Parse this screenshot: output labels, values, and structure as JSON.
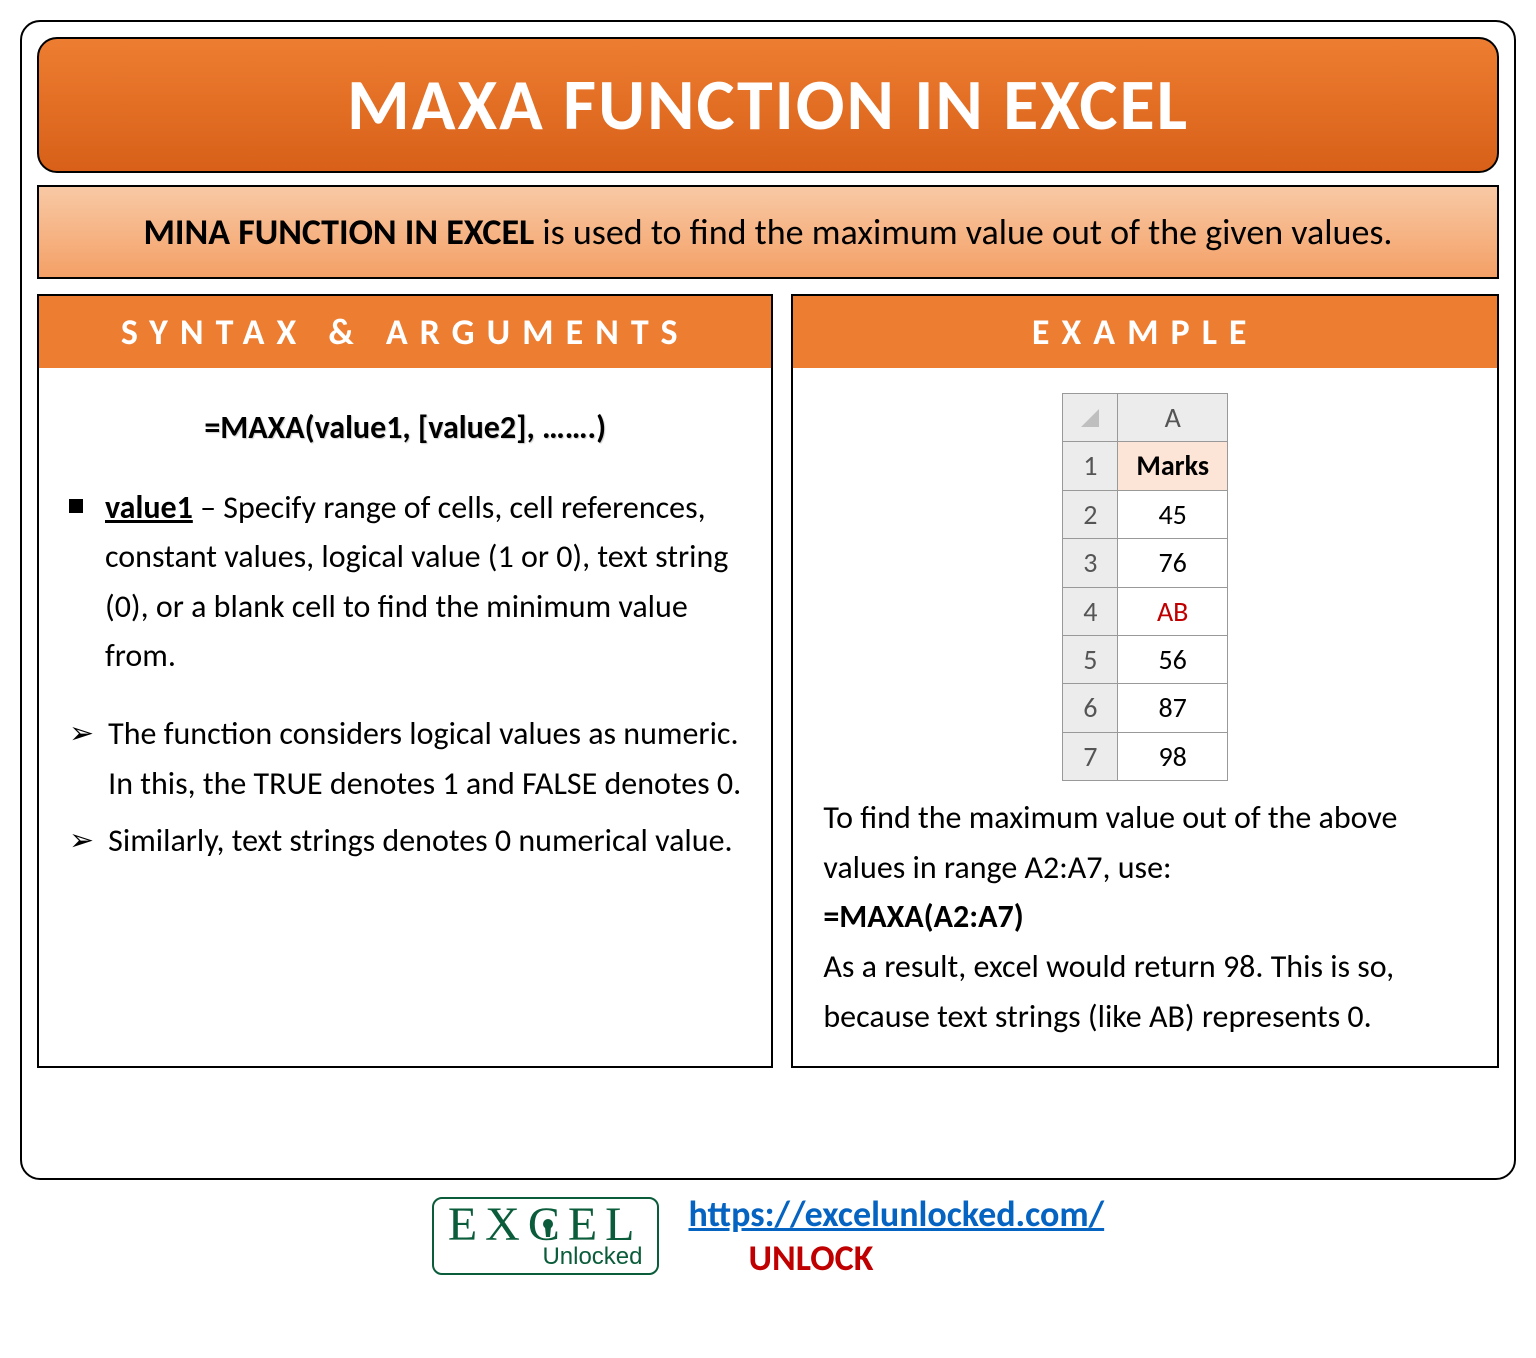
{
  "title": "MAXA FUNCTION IN EXCEL",
  "description": {
    "bold": "MINA FUNCTION IN EXCEL",
    "rest": " is used to find the maximum value out of the given values."
  },
  "syntax": {
    "header": "SYNTAX & ARGUMENTS",
    "formula": "=MAXA(value1, [value2], …….)",
    "value1_label": "value1",
    "value1_text": " – Specify range of cells, cell references, constant values, logical value (1 or 0), text string (0), or a blank cell to find the minimum value from.",
    "note1": "The function considers logical values as numeric. In this, the TRUE denotes 1 and FALSE denotes 0.",
    "note2": "Similarly, text strings denotes 0 numerical value."
  },
  "example": {
    "header": "EXAMPLE",
    "table": {
      "col_letter": "A",
      "header_label": "Marks",
      "rows": [
        {
          "n": "1",
          "v": "Marks",
          "is_header": true
        },
        {
          "n": "2",
          "v": "45"
        },
        {
          "n": "3",
          "v": "76"
        },
        {
          "n": "4",
          "v": "AB",
          "is_ab": true
        },
        {
          "n": "5",
          "v": "56"
        },
        {
          "n": "6",
          "v": "87"
        },
        {
          "n": "7",
          "v": "98"
        }
      ]
    },
    "text1": "To find the maximum value out of the above values in range A2:A7, use:",
    "formula": "=MAXA(A2:A7)",
    "text2": "As a result, excel would return 98. This is so, because text strings (like AB) represents 0."
  },
  "footer": {
    "logo_top": "EXCEL",
    "logo_bottom": "Unlocked",
    "url": "https://excelunlocked.com/",
    "unlock": "UNLOCK"
  }
}
